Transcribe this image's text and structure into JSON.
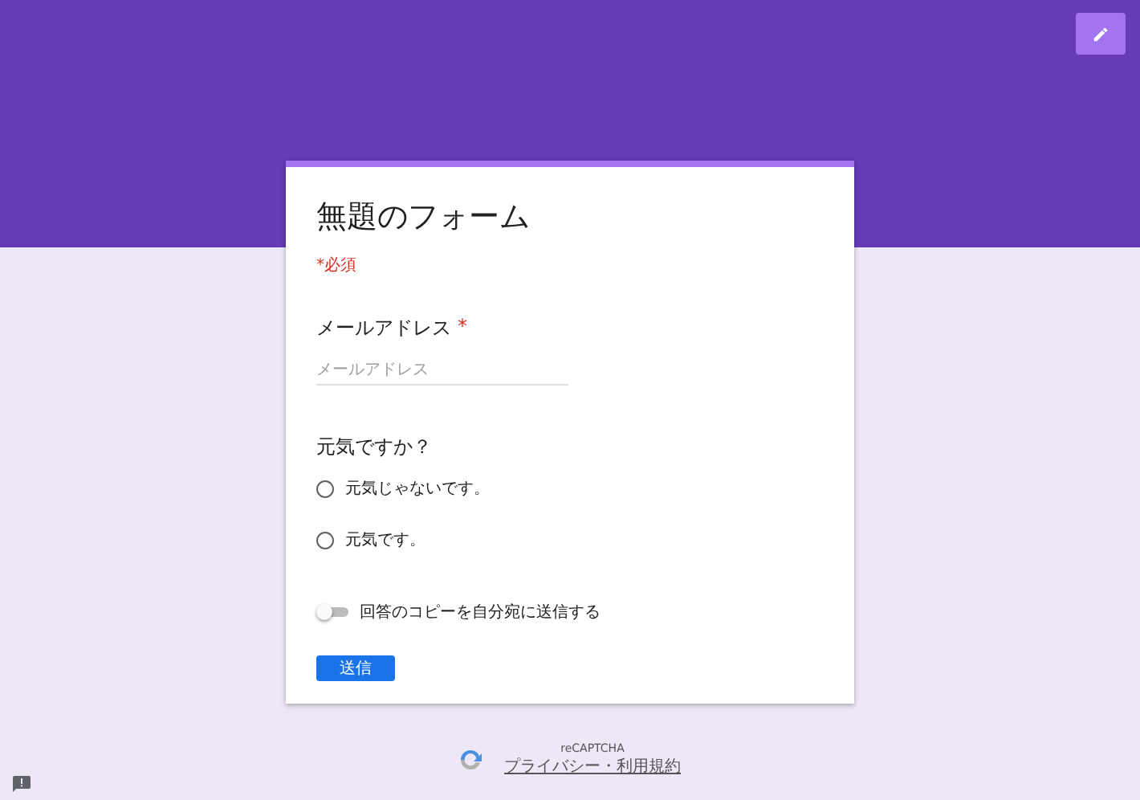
{
  "form": {
    "title": "無題のフォーム",
    "required_note": "*必須"
  },
  "questions": [
    {
      "kind": "text",
      "label": "メールアドレス",
      "required": true,
      "required_mark": "*",
      "placeholder": "メールアドレス"
    },
    {
      "kind": "radio",
      "label": "元気ですか？",
      "options": [
        {
          "label": "元気じゃないです。",
          "selected": false
        },
        {
          "label": "元気です。",
          "selected": false
        }
      ]
    }
  ],
  "copy_toggle": {
    "label": "回答のコピーを自分宛に送信する",
    "on": false
  },
  "submit": {
    "label": "送信"
  },
  "recaptcha": {
    "title": "reCAPTCHA",
    "link": "プライバシー・利用規約"
  }
}
